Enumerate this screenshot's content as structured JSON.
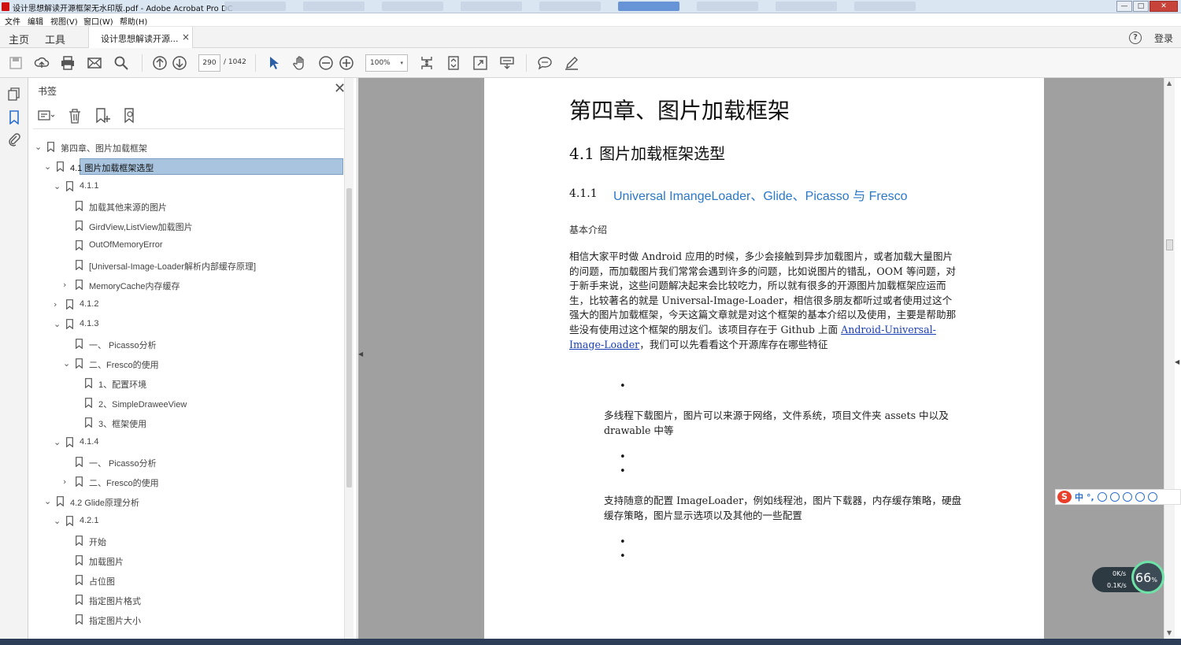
{
  "window": {
    "title": "设计思想解读开源框架无水印版.pdf - Adobe Acrobat Pro DC",
    "controls": {
      "minimize": "—",
      "maximize": "□",
      "close": "✕"
    }
  },
  "menu": [
    "文件",
    "编辑",
    "视图(V)",
    "窗口(W)",
    "帮助(H)"
  ],
  "tabs": {
    "home": "主页",
    "tools": "工具",
    "document": "设计思想解读开源...",
    "close": "×",
    "help": "?",
    "login": "登录"
  },
  "toolbar": {
    "page_current": "290",
    "page_total": "/ 1042",
    "zoom": "100%",
    "zoom_arrow": "▾"
  },
  "bookmarks": {
    "title": "书签",
    "close": "✕",
    "items": [
      {
        "label": "第四章、图片加载框架",
        "level": 0,
        "chevron": "⌄"
      },
      {
        "label": "4.1 图片加载框架选型",
        "level": 1,
        "chevron": "⌄",
        "selected": true
      },
      {
        "label": "4.1.1",
        "level": 2,
        "chevron": "⌄"
      },
      {
        "label": "加载其他来源的图片",
        "level": 3,
        "chevron": ""
      },
      {
        "label": "GirdView,ListView加载图片",
        "level": 3,
        "chevron": ""
      },
      {
        "label": "OutOfMemoryError",
        "level": 3,
        "chevron": ""
      },
      {
        "label": "[Universal-Image-Loader解析内部缓存原理]",
        "level": 3,
        "chevron": ""
      },
      {
        "label": "MemoryCache内存缓存",
        "level": 3,
        "chevron": "›"
      },
      {
        "label": "4.1.2",
        "level": 2,
        "chevron": "›"
      },
      {
        "label": "4.1.3",
        "level": 2,
        "chevron": "⌄"
      },
      {
        "label": "一、 Picasso分析",
        "level": 3,
        "chevron": ""
      },
      {
        "label": "二、Fresco的使用",
        "level": 3,
        "chevron": "⌄"
      },
      {
        "label": "1、配置环境",
        "level": 4,
        "chevron": ""
      },
      {
        "label": "2、SimpleDraweeView",
        "level": 4,
        "chevron": ""
      },
      {
        "label": "3、框架使用",
        "level": 4,
        "chevron": ""
      },
      {
        "label": "4.1.4",
        "level": 2,
        "chevron": "⌄"
      },
      {
        "label": "一、 Picasso分析",
        "level": 3,
        "chevron": ""
      },
      {
        "label": "二、Fresco的使用",
        "level": 3,
        "chevron": "›"
      },
      {
        "label": "4.2 Glide原理分析",
        "level": 1,
        "chevron": "⌄"
      },
      {
        "label": "4.2.1",
        "level": 2,
        "chevron": "⌄"
      },
      {
        "label": "开始",
        "level": 3,
        "chevron": ""
      },
      {
        "label": "加载图片",
        "level": 3,
        "chevron": ""
      },
      {
        "label": "占位图",
        "level": 3,
        "chevron": ""
      },
      {
        "label": "指定图片格式",
        "level": 3,
        "chevron": ""
      },
      {
        "label": "指定图片大小",
        "level": 3,
        "chevron": ""
      }
    ]
  },
  "document": {
    "chapter_title": "第四章、图片加载框架",
    "section_title": "4.1  图片加载框架选型",
    "subsection_number": "4.1.1",
    "subsection_title": "Universal ImangeLoader、Glide、Picasso 与 Fresco",
    "intro_heading": "基本介绍",
    "intro_before_link": "相信大家平时做 Android 应用的时候，多少会接触到异步加载图片，或者加载大量图片的问题，而加载图片我们常常会遇到许多的问题，比如说图片的错乱，OOM 等问题，对于新手来说，这些问题解决起来会比较吃力，所以就有很多的开源图片加载框架应运而生，比较著名的就是 Universal-Image-Loader，相信很多朋友都听过或者使用过这个强大的图片加载框架，今天这篇文章就是对这个框架的基本介绍以及使用，主要是帮助那些没有使用过这个框架的朋友们。该项目存在于 Github 上面 ",
    "intro_link": "Android-Universal-Image-Loader",
    "intro_after_link": "，我们可以先看看这个开源库存在哪些特征",
    "bullet": "•",
    "feature1": "多线程下载图片，图片可以来源于网络，文件系统，项目文件夹 assets 中以及 drawable 中等",
    "feature2": "支持随意的配置 ImageLoader，例如线程池，图片下载器，内存缓存策略，硬盘缓存策略，图片显示选项以及其他的一些配置"
  },
  "ime": {
    "logo": "S",
    "lang": "中",
    "punct": "°,"
  },
  "network_widget": {
    "percent": "66",
    "percent_unit": "%",
    "down": "0K/s",
    "up": "0.1K/s"
  },
  "colors": {
    "selection": "#a8c4df",
    "heading_link": "#2a78c8",
    "link": "#1a3fb4",
    "viewer_bg": "#a0a0a0"
  }
}
